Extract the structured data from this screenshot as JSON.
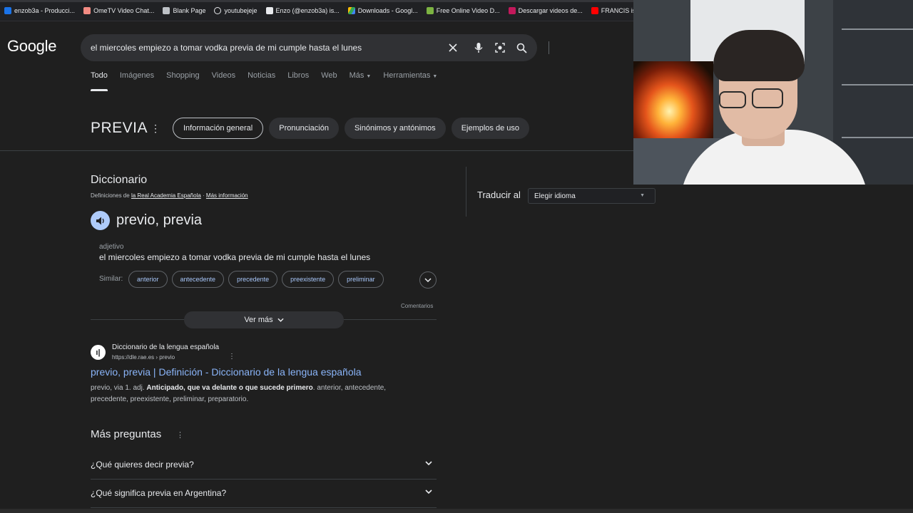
{
  "bookmarks": [
    {
      "label": "enzob3a - Producci...",
      "color": "#1a73e8"
    },
    {
      "label": "OmeTV Video Chat...",
      "color": "#f28b82"
    },
    {
      "label": "Blank Page",
      "color": "#bdc1c6"
    },
    {
      "label": "youtubejeje",
      "color": "#e8eaed"
    },
    {
      "label": "Enzo (@enzob3a) is...",
      "color": "#e8eaed"
    },
    {
      "label": "Downloads - Googl...",
      "color": "#34a853"
    },
    {
      "label": "Free Online Video D...",
      "color": "#7cb342"
    },
    {
      "label": "Descargar videos de...",
      "color": "#c2185b"
    },
    {
      "label": "FRANCIS is a",
      "color": "#ff0000"
    }
  ],
  "header": {
    "logo": "Google",
    "search_query": "el miercoles empiezo a tomar vodka previa de mi cumple hasta el lunes"
  },
  "tabs": [
    {
      "label": "Todo",
      "active": true
    },
    {
      "label": "Imágenes"
    },
    {
      "label": "Shopping"
    },
    {
      "label": "Videos"
    },
    {
      "label": "Noticias"
    },
    {
      "label": "Libros"
    },
    {
      "label": "Web"
    },
    {
      "label": "Más"
    },
    {
      "label": "Herramientas"
    }
  ],
  "word": {
    "title": "PREVIA",
    "chips": [
      "Información general",
      "Pronunciación",
      "Sinónimos y antónimos",
      "Ejemplos de uso"
    ]
  },
  "dictionary": {
    "heading": "Diccionario",
    "source_prefix": "Definiciones de",
    "source_link": "la Real Academia Española",
    "source_sep": "·",
    "more_info": "Más información",
    "headword": "previo, previa",
    "pos": "adjetivo",
    "definition": "el miercoles empiezo a tomar vodka previa de mi cumple hasta el lunes",
    "similar_label": "Similar:",
    "synonyms": [
      "anterior",
      "antecedente",
      "precedente",
      "preexistente",
      "preliminar"
    ],
    "comments": "Comentarios",
    "see_more": "Ver más"
  },
  "translate": {
    "label": "Traducir al",
    "select_value": "Elegir idioma"
  },
  "result": {
    "site_name": "Diccionario de la lengua española",
    "url": "https://dle.rae.es › previo",
    "title": "previo, previa | Definición - Diccionario de la lengua española",
    "snippet_prefix": "previo, via 1. adj.",
    "snippet_bold": "Anticipado, que va delante o que sucede primero",
    "snippet_suffix": ". anterior, antecedente, precedente, preexistente, preliminar, preparatorio."
  },
  "paa": {
    "heading": "Más preguntas",
    "questions": [
      "¿Qué quieres decir previa?",
      "¿Qué significa previa en Argentina?"
    ]
  },
  "colors": {
    "background": "#1f1f1f",
    "link": "#8ab4f8",
    "accent_speaker": "#aecbfa"
  }
}
